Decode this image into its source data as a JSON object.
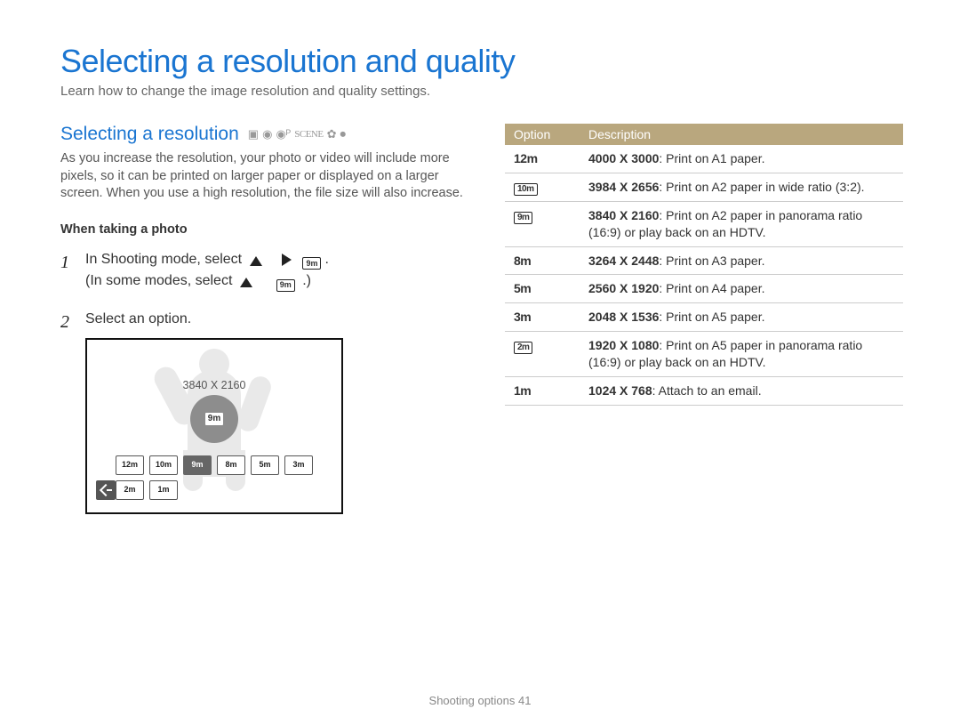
{
  "page": {
    "title": "Selecting a resolution and quality",
    "subtitle": "Learn how to change the image resolution and quality settings."
  },
  "section": {
    "heading": "Selecting a resolution",
    "body": "As you increase the resolution, your photo or video will include more pixels, so it can be printed on larger paper or displayed on a larger screen. When you use a high resolution, the file size will also increase.",
    "sub": "When taking a photo"
  },
  "steps": {
    "s1a": "In Shooting mode, select",
    "s1b": "(In some modes, select",
    "s1end": ".)",
    "s2": "Select an option.",
    "icon9m_a": "9m",
    "icon9m_b": "9m"
  },
  "screen": {
    "reslabel": "3840 X 2160",
    "sel": "9m",
    "row1": [
      "12m",
      "10m",
      "9m",
      "8m",
      "5m",
      "3m"
    ],
    "row2": [
      "2m",
      "1m"
    ]
  },
  "table": {
    "h1": "Option",
    "h2": "Description",
    "rows": [
      {
        "icon": "12m",
        "icon_style": "plain",
        "bold": "4000 X 3000",
        "rest": ": Print on A1 paper."
      },
      {
        "icon": "10m",
        "icon_style": "box",
        "bold": "3984 X 2656",
        "rest": ": Print on A2 paper in wide ratio (3:2)."
      },
      {
        "icon": "9m",
        "icon_style": "box",
        "bold": "3840 X 2160",
        "rest": ": Print on A2 paper in panorama ratio (16:9) or play back on an HDTV."
      },
      {
        "icon": "8m",
        "icon_style": "plain",
        "bold": "3264 X 2448",
        "rest": ": Print on A3 paper."
      },
      {
        "icon": "5m",
        "icon_style": "plain",
        "bold": "2560 X 1920",
        "rest": ": Print on A4 paper."
      },
      {
        "icon": "3m",
        "icon_style": "plain",
        "bold": "2048 X 1536",
        "rest": ": Print on A5 paper."
      },
      {
        "icon": "2m",
        "icon_style": "box",
        "bold": "1920 X 1080",
        "rest": ": Print on A5 paper in panorama ratio (16:9) or play back on an HDTV."
      },
      {
        "icon": "1m",
        "icon_style": "plain",
        "bold": "1024 X 768",
        "rest": ": Attach to an email."
      }
    ]
  },
  "footer": {
    "section": "Shooting options",
    "page": "41",
    "combined": "Shooting options  41"
  },
  "chart_data": {
    "type": "table",
    "title": "Photo resolution options",
    "columns": [
      "Option",
      "Description"
    ],
    "rows": [
      [
        "12m",
        "4000 X 3000: Print on A1 paper."
      ],
      [
        "10m",
        "3984 X 2656: Print on A2 paper in wide ratio (3:2)."
      ],
      [
        "9m",
        "3840 X 2160: Print on A2 paper in panorama ratio (16:9) or play back on an HDTV."
      ],
      [
        "8m",
        "3264 X 2448: Print on A3 paper."
      ],
      [
        "5m",
        "2560 X 1920: Print on A4 paper."
      ],
      [
        "3m",
        "2048 X 1536: Print on A5 paper."
      ],
      [
        "2m",
        "1920 X 1080: Print on A5 paper in panorama ratio (16:9) or play back on an HDTV."
      ],
      [
        "1m",
        "1024 X 768: Attach to an email."
      ]
    ]
  }
}
